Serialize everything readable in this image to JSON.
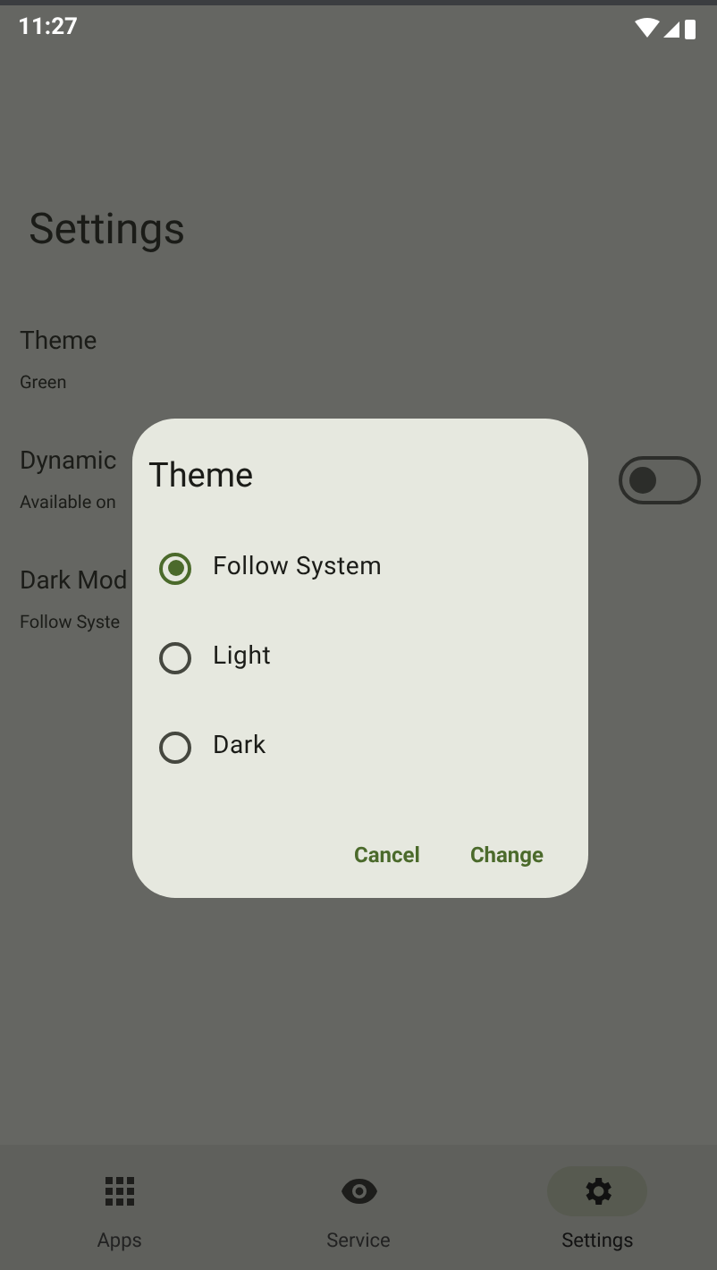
{
  "status_bar": {
    "time": "11:27"
  },
  "title": "Settings",
  "settings": [
    {
      "kind": "plain",
      "title": "Theme",
      "subtitle": "Green"
    },
    {
      "kind": "switch",
      "title": "Dynamic",
      "subtitle": "Available on",
      "on": false
    },
    {
      "kind": "plain",
      "title": "Dark Mod",
      "subtitle": "Follow Syste"
    }
  ],
  "dialog": {
    "title": "Theme",
    "options": [
      {
        "label": "Follow System",
        "selected": true
      },
      {
        "label": "Light",
        "selected": false
      },
      {
        "label": "Dark",
        "selected": false
      }
    ],
    "buttons": [
      "Cancel",
      "Change"
    ]
  },
  "nav": [
    {
      "kind": "grid",
      "label": "Apps",
      "selected": false
    },
    {
      "kind": "eye",
      "label": "Service",
      "selected": false
    },
    {
      "kind": "gear",
      "label": "Settings",
      "selected": true
    }
  ]
}
